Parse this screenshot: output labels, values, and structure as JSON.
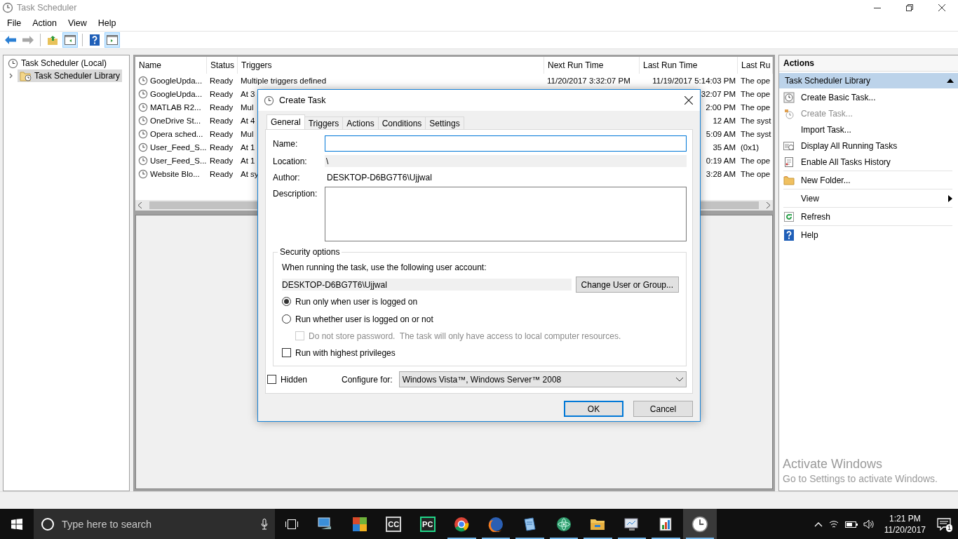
{
  "window": {
    "title": "Task Scheduler"
  },
  "menu": [
    "File",
    "Action",
    "View",
    "Help"
  ],
  "toolbar": [
    {
      "kind": "back",
      "disabled": false,
      "pressed": false
    },
    {
      "kind": "forward",
      "disabled": true,
      "pressed": false
    },
    {
      "kind": "up",
      "disabled": false,
      "pressed": false
    },
    {
      "kind": "tree-pane",
      "disabled": false,
      "pressed": true
    },
    {
      "kind": "help",
      "disabled": false,
      "pressed": false
    },
    {
      "kind": "action-pane",
      "disabled": false,
      "pressed": true
    }
  ],
  "tree": [
    {
      "label": "Task Scheduler (Local)",
      "selected": false,
      "children": [
        {
          "label": "Task Scheduler Library",
          "selected": true,
          "expanded": false
        }
      ]
    }
  ],
  "table": {
    "columns": [
      "Name",
      "Status",
      "Triggers",
      "Next Run Time",
      "Last Run Time",
      "Last Ru"
    ],
    "rows": [
      {
        "name": "GoogleUpda...",
        "status": "Ready",
        "triggers": "Multiple triggers defined",
        "next_run_time": "11/20/2017 3:32:07 PM",
        "last_run_time": "11/19/2017 5:14:03 PM",
        "last_run_result": "The ope"
      },
      {
        "name": "GoogleUpda...",
        "status": "Ready",
        "triggers": "At 3",
        "last_run_time": "32:07 PM",
        "last_run_result": "The ope"
      },
      {
        "name": "MATLAB R2...",
        "status": "Ready",
        "triggers": "Mul",
        "last_run_time": "2:00 PM",
        "last_run_result": "The ope"
      },
      {
        "name": "OneDrive St...",
        "status": "Ready",
        "triggers": "At 4",
        "last_run_time": "12 AM",
        "last_run_result": "The syst"
      },
      {
        "name": "Opera sched...",
        "status": "Ready",
        "triggers": "Mul",
        "last_run_time": "5:09 AM",
        "last_run_result": "The syst"
      },
      {
        "name": "User_Feed_S...",
        "status": "Ready",
        "triggers": "At 1",
        "last_run_time": "35 AM",
        "last_run_result": "(0x1)"
      },
      {
        "name": "User_Feed_S...",
        "status": "Ready",
        "triggers": "At 1",
        "last_run_time": "0:19 AM",
        "last_run_result": "The ope"
      },
      {
        "name": "Website Blo...",
        "status": "Ready",
        "triggers": "At sy",
        "last_run_time": "3:28 AM",
        "last_run_result": "The ope"
      }
    ]
  },
  "actions": {
    "title": "Actions",
    "section": {
      "label": "Task Scheduler Library",
      "expanded": true
    },
    "groups": [
      [
        {
          "kind": "wizard",
          "label": "Create Basic Task...",
          "disabled": false
        },
        {
          "kind": "new",
          "label": "Create Task...",
          "disabled": true
        },
        {
          "kind": "plain",
          "label": "Import Task...",
          "disabled": false
        },
        {
          "kind": "running",
          "label": "Display All Running Tasks",
          "disabled": false
        },
        {
          "kind": "history",
          "label": "Enable All Tasks History",
          "disabled": false
        }
      ],
      [
        {
          "kind": "folder",
          "label": "New Folder...",
          "disabled": false
        }
      ],
      [
        {
          "kind": "submenu",
          "label": "View",
          "disabled": false
        }
      ],
      [
        {
          "kind": "refresh",
          "label": "Refresh",
          "disabled": false
        }
      ],
      [
        {
          "kind": "help",
          "label": "Help",
          "disabled": false
        }
      ]
    ]
  },
  "dialog": {
    "title": "Create Task",
    "tabs": [
      {
        "label": "General",
        "selected": true
      },
      {
        "label": "Triggers",
        "selected": false
      },
      {
        "label": "Actions",
        "selected": false
      },
      {
        "label": "Conditions",
        "selected": false
      },
      {
        "label": "Settings",
        "selected": false
      }
    ],
    "name_field": {
      "label": "Name:",
      "focused": true
    },
    "location": {
      "label": "Location:",
      "value": "\\"
    },
    "author": {
      "label": "Author:",
      "value": "DESKTOP-D6BG7T6\\Ujjwal"
    },
    "description": {
      "label": "Description:"
    },
    "security": {
      "title": "Security options",
      "prompt": "When running the task, use the following user account:",
      "account": "DESKTOP-D6BG7T6\\Ujjwal",
      "change_button": "Change User or Group...",
      "options": [
        {
          "kind": "radio",
          "label": "Run only when user is logged on",
          "selected": true
        },
        {
          "kind": "radio",
          "label": "Run whether user is logged on or not",
          "selected": false
        },
        {
          "kind": "subcheckbox",
          "label": "Do not store password.  The task will only have access to local computer resources.",
          "checked": false,
          "disabled": true
        },
        {
          "kind": "checkbox",
          "label": "Run with highest privileges",
          "checked": false,
          "disabled": false
        }
      ]
    },
    "hidden": {
      "label": "Hidden",
      "checked": false
    },
    "configure": {
      "label": "Configure for:",
      "value": "Windows Vista™, Windows Server™ 2008"
    },
    "buttons": [
      {
        "label": "OK",
        "default": true
      },
      {
        "label": "Cancel",
        "default": false
      }
    ]
  },
  "activation_notice": {
    "title": "Activate Windows",
    "text": "Go to Settings to activate Windows."
  },
  "taskbar": {
    "search_placeholder": "Type here to search",
    "apps": [
      {
        "kind": "computer",
        "running": false,
        "selected": false
      },
      {
        "kind": "tiles",
        "running": false,
        "selected": false
      },
      {
        "kind": "badge",
        "label": "CC",
        "color": "#d0d0d0",
        "running": false,
        "selected": false
      },
      {
        "kind": "badge",
        "label": "PC",
        "color": "#21d789",
        "running": false,
        "selected": false
      },
      {
        "kind": "ring",
        "running": true,
        "selected": false
      },
      {
        "kind": "globe",
        "running": true,
        "selected": false
      },
      {
        "kind": "notepad",
        "running": true,
        "selected": false
      },
      {
        "kind": "atom",
        "running": true,
        "selected": false
      },
      {
        "kind": "folder",
        "running": true,
        "selected": false
      },
      {
        "kind": "monitor",
        "running": true,
        "selected": false
      },
      {
        "kind": "chart",
        "running": true,
        "selected": false
      },
      {
        "kind": "clock",
        "running": true,
        "selected": true
      }
    ],
    "time": "1:21 PM",
    "date": "11/20/2017",
    "notifications": "1"
  }
}
